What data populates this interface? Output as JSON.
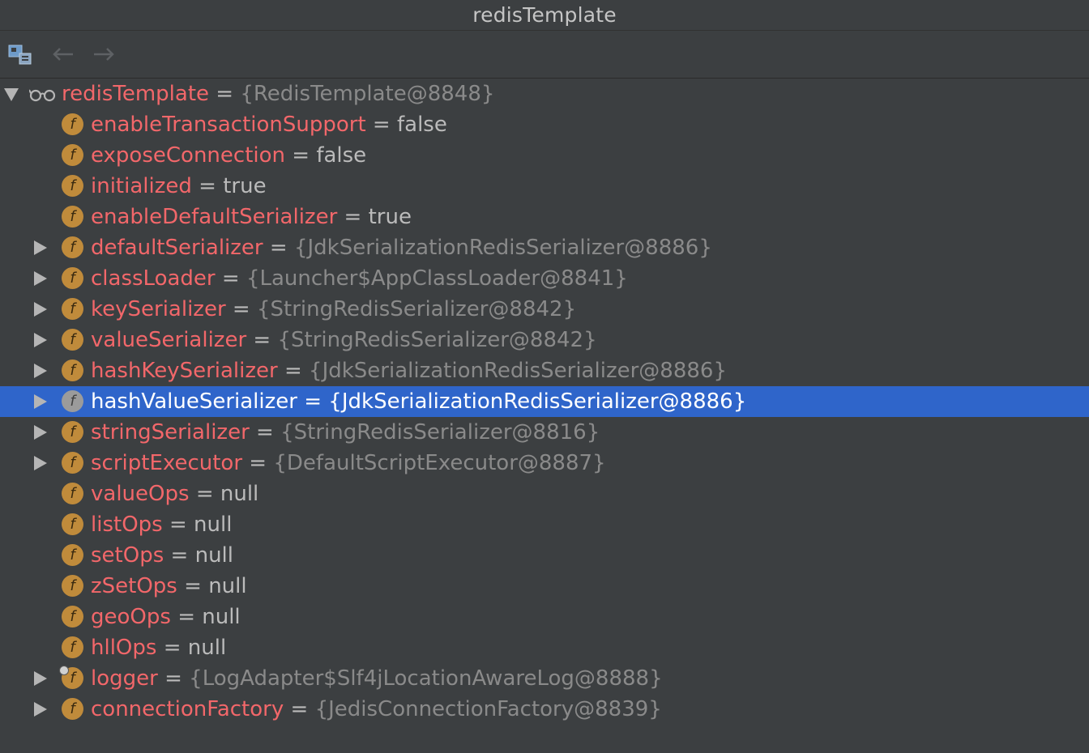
{
  "window": {
    "title": "redisTemplate"
  },
  "toolbar": {
    "view_icon": "variables-view-icon",
    "back_icon": "arrow-left-icon",
    "forward_icon": "arrow-right-icon"
  },
  "tree": {
    "root": {
      "name": "redisTemplate",
      "value": "{RedisTemplate@8848}",
      "icon": "watch-glasses-icon",
      "expanded": true
    },
    "fields": [
      {
        "name": "enableTransactionSupport",
        "value": "false",
        "expandable": false
      },
      {
        "name": "exposeConnection",
        "value": "false",
        "expandable": false
      },
      {
        "name": "initialized",
        "value": "true",
        "expandable": false
      },
      {
        "name": "enableDefaultSerializer",
        "value": "true",
        "expandable": false
      },
      {
        "name": "defaultSerializer",
        "value": "{JdkSerializationRedisSerializer@8886}",
        "expandable": true
      },
      {
        "name": "classLoader",
        "value": "{Launcher$AppClassLoader@8841}",
        "expandable": true
      },
      {
        "name": "keySerializer",
        "value": "{StringRedisSerializer@8842}",
        "expandable": true
      },
      {
        "name": "valueSerializer",
        "value": "{StringRedisSerializer@8842}",
        "expandable": true
      },
      {
        "name": "hashKeySerializer",
        "value": "{JdkSerializationRedisSerializer@8886}",
        "expandable": true
      },
      {
        "name": "hashValueSerializer",
        "value": "{JdkSerializationRedisSerializer@8886}",
        "expandable": true,
        "selected": true
      },
      {
        "name": "stringSerializer",
        "value": "{StringRedisSerializer@8816}",
        "expandable": true
      },
      {
        "name": "scriptExecutor",
        "value": "{DefaultScriptExecutor@8887}",
        "expandable": true
      },
      {
        "name": "valueOps",
        "value": "null",
        "expandable": false
      },
      {
        "name": "listOps",
        "value": "null",
        "expandable": false
      },
      {
        "name": "setOps",
        "value": "null",
        "expandable": false
      },
      {
        "name": "zSetOps",
        "value": "null",
        "expandable": false
      },
      {
        "name": "geoOps",
        "value": "null",
        "expandable": false
      },
      {
        "name": "hllOps",
        "value": "null",
        "expandable": false
      },
      {
        "name": "logger",
        "value": "{LogAdapter$Slf4jLocationAwareLog@8888}",
        "expandable": true
      },
      {
        "name": "connectionFactory",
        "value": "{JedisConnectionFactory@8839}",
        "expandable": true
      }
    ],
    "eq": "=",
    "field_icon_letter": "f"
  },
  "colors": {
    "background": "#3c3f41",
    "field_name": "#f2676a",
    "object_ref": "#8a8a8a",
    "selection": "#2f65ca",
    "field_icon": "#c08b3b"
  }
}
